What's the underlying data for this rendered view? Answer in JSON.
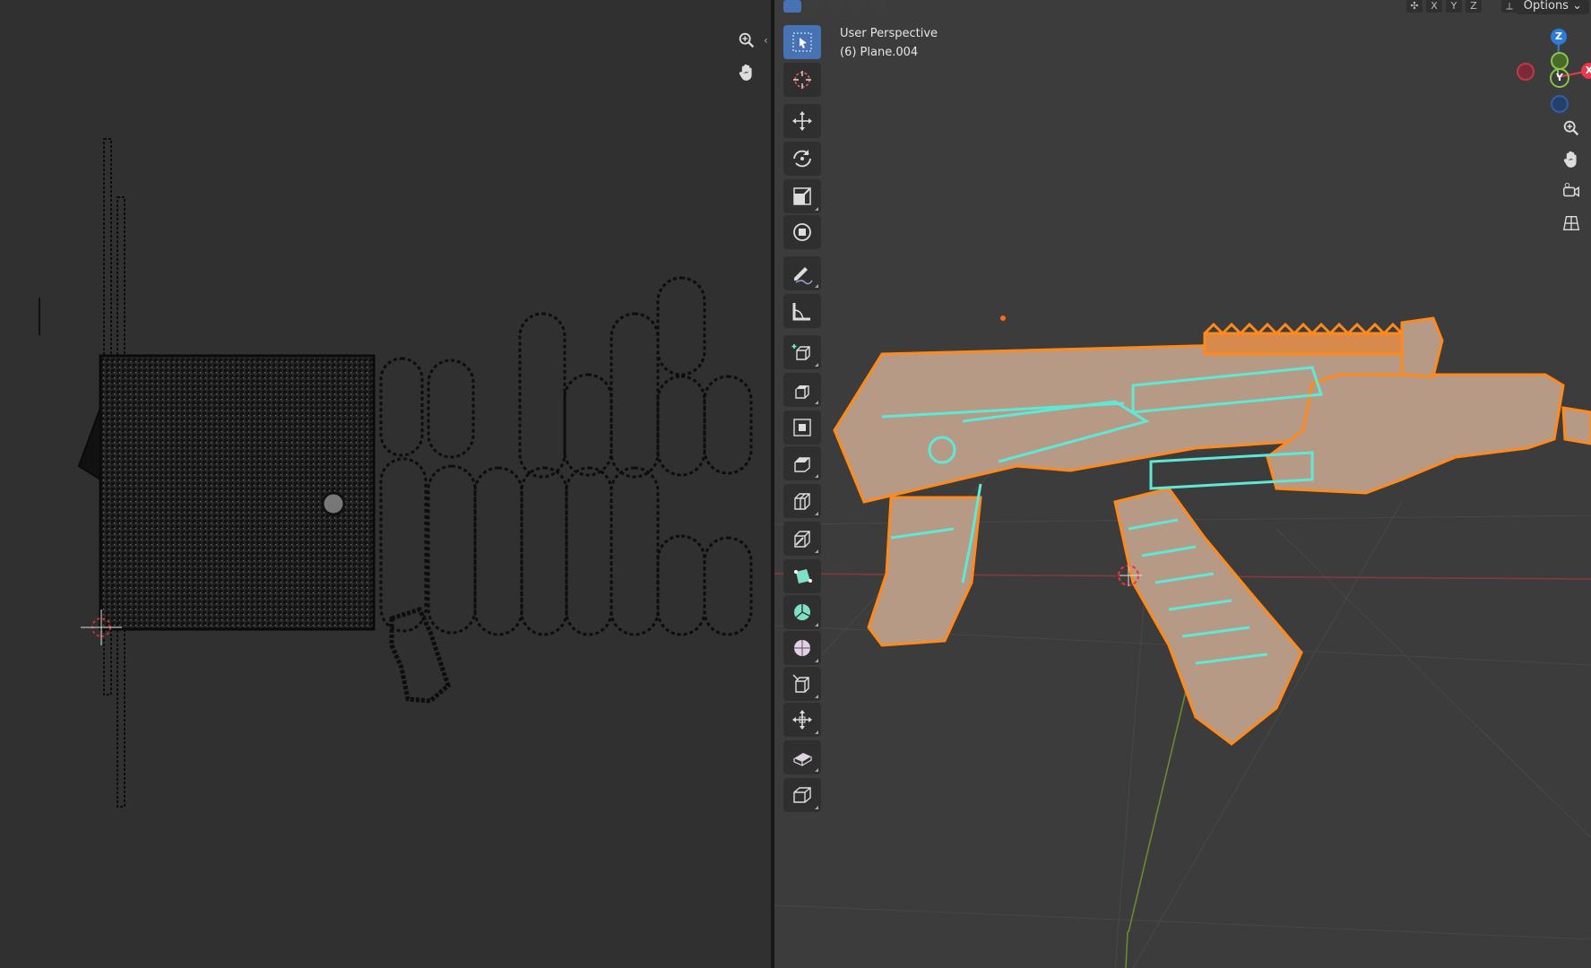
{
  "viewport": {
    "view_name": "User Perspective",
    "object_name": "(6) Plane.004",
    "options_label": "Options",
    "axis_buttons": [
      "X",
      "Y",
      "Z"
    ],
    "gizmo": {
      "z": "Z",
      "y": "Y",
      "x": "X"
    }
  },
  "colors": {
    "panel_bg": "#303030",
    "viewport_bg": "#3c3c3c",
    "selection_orange": "#ff8a1c",
    "selection_cyan": "#5fe8d6",
    "active_tool": "#4772b3"
  },
  "toolbar": {
    "tools": [
      {
        "name": "select-box",
        "icon": "cursor-arrow-icon",
        "active": true
      },
      {
        "name": "cursor",
        "icon": "3d-cursor-icon"
      },
      {
        "name": "move",
        "icon": "move-icon"
      },
      {
        "name": "rotate",
        "icon": "rotate-icon"
      },
      {
        "name": "scale",
        "icon": "scale-icon"
      },
      {
        "name": "transform",
        "icon": "transform-icon"
      },
      {
        "name": "annotate",
        "icon": "annotate-pencil-icon"
      },
      {
        "name": "measure",
        "icon": "measure-ruler-icon"
      },
      {
        "name": "add-cube",
        "icon": "add-cube-icon"
      },
      {
        "name": "extrude",
        "icon": "extrude-icon"
      },
      {
        "name": "inset",
        "icon": "inset-faces-icon"
      },
      {
        "name": "bevel",
        "icon": "bevel-icon"
      },
      {
        "name": "loop-cut",
        "icon": "loop-cut-icon"
      },
      {
        "name": "knife",
        "icon": "knife-icon"
      },
      {
        "name": "poly-build",
        "icon": "poly-build-icon"
      },
      {
        "name": "spin",
        "icon": "spin-icon"
      },
      {
        "name": "smooth",
        "icon": "smooth-sphere-icon"
      },
      {
        "name": "edge-slide",
        "icon": "edge-slide-icon"
      },
      {
        "name": "shrink-fatten",
        "icon": "shrink-fatten-icon"
      },
      {
        "name": "shear",
        "icon": "shear-icon"
      },
      {
        "name": "rip-region",
        "icon": "rip-region-icon"
      }
    ]
  }
}
